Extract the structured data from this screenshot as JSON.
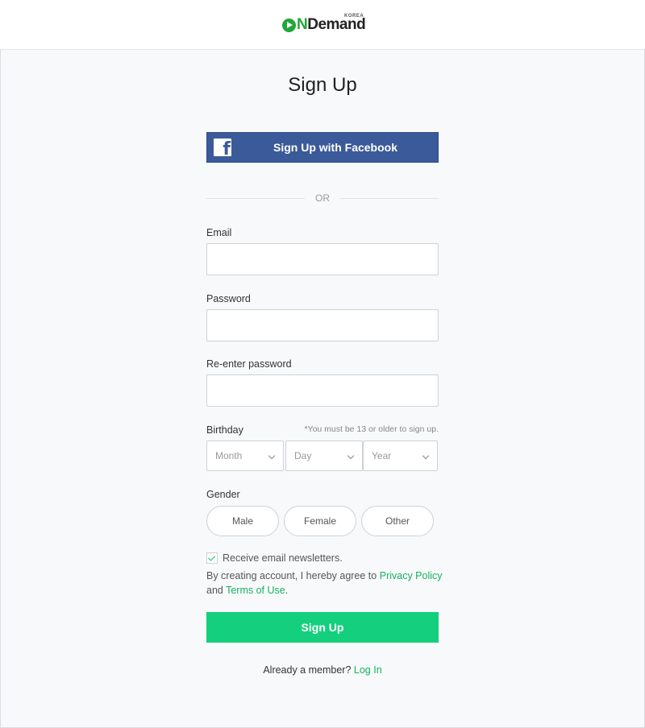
{
  "brand": {
    "mark_letter": "N",
    "demand": "Demand",
    "korea": "KOREA"
  },
  "page": {
    "title": "Sign Up"
  },
  "facebook": {
    "label": "Sign Up with Facebook",
    "icon": "f"
  },
  "divider": {
    "text": "OR"
  },
  "fields": {
    "email": {
      "label": "Email",
      "value": ""
    },
    "password": {
      "label": "Password",
      "value": ""
    },
    "reenter": {
      "label": "Re-enter password",
      "value": ""
    }
  },
  "birthday": {
    "label": "Birthday",
    "note": "*You must be 13 or older to sign up.",
    "month": "Month",
    "day": "Day",
    "year": "Year"
  },
  "gender": {
    "label": "Gender",
    "options": [
      "Male",
      "Female",
      "Other"
    ]
  },
  "newsletter": {
    "label": "Receive email newsletters.",
    "checked": true
  },
  "agreement": {
    "prefix": "By creating account, I hereby agree to",
    "privacy": "Privacy Policy",
    "and": "and",
    "terms": "Terms of Use",
    "suffix": "."
  },
  "submit": {
    "label": "Sign Up"
  },
  "footer": {
    "question": "Already a member?",
    "login": "Log In"
  },
  "colors": {
    "accent": "#14d07e",
    "link": "#13b35f",
    "facebook": "#3b5a9a",
    "logo_green": "#20a739"
  }
}
